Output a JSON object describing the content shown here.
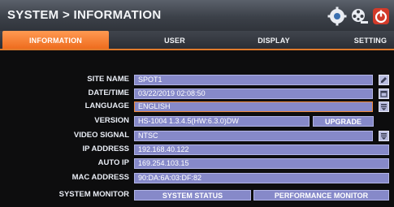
{
  "header": {
    "title": "SYSTEM > INFORMATION",
    "icons": [
      "gear-icon",
      "film-reel-icon",
      "power-icon"
    ]
  },
  "tabs": [
    {
      "label": "INFORMATION",
      "active": true
    },
    {
      "label": "USER",
      "active": false
    },
    {
      "label": "DISPLAY",
      "active": false
    },
    {
      "label": "SETTING",
      "active": false
    }
  ],
  "info": {
    "site_name": {
      "label": "SITE NAME",
      "value": "SPOT1"
    },
    "date_time": {
      "label": "DATE/TIME",
      "value": "03/22/2019 02:08:50"
    },
    "language": {
      "label": "LANGUAGE",
      "value": "ENGLISH"
    },
    "version": {
      "label": "VERSION",
      "value": "HS-1004 1.3.4.5(HW:6.3.0)DW",
      "button": "UPGRADE"
    },
    "video_signal": {
      "label": "VIDEO SIGNAL",
      "value": "NTSC"
    },
    "ip_address": {
      "label": "IP ADDRESS",
      "value": "192.168.40.122"
    },
    "auto_ip": {
      "label": "AUTO IP",
      "value": "169.254.103.15"
    },
    "mac_address": {
      "label": "MAC ADDRESS",
      "value": "90:DA:6A:03:DF:82"
    },
    "system_monitor": {
      "label": "SYSTEM MONITOR",
      "status_button": "SYSTEM STATUS",
      "performance_button": "PERFORMANCE MONITOR"
    }
  },
  "colors": {
    "accent": "#ee6a1c",
    "field": "#8689c9",
    "background": "#0b0b0c"
  }
}
